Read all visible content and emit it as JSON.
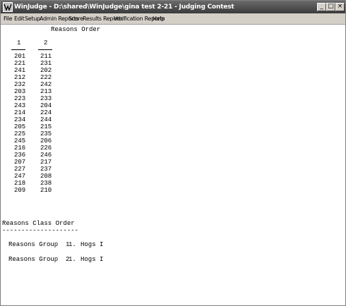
{
  "window": {
    "title": "WinJudge - D:\\shared\\WinJudge\\gina test 2-21 - Judging Contest",
    "buttons": {
      "minimize": "_",
      "restore": "□",
      "close": "×"
    }
  },
  "menu": {
    "items": [
      "File",
      "Edit",
      "Setup",
      "Admin Reports",
      "Score",
      "Results Reports",
      "Verification Reports",
      "Help"
    ]
  },
  "report": {
    "heading": "Reasons Order",
    "columns": [
      {
        "header": "1",
        "values": [
          "201",
          "221",
          "241",
          "212",
          "232",
          "203",
          "223",
          "243",
          "214",
          "234",
          "205",
          "225",
          "245",
          "216",
          "236",
          "207",
          "227",
          "247",
          "218",
          "209"
        ]
      },
      {
        "header": "2",
        "values": [
          "211",
          "231",
          "202",
          "222",
          "242",
          "213",
          "233",
          "204",
          "224",
          "244",
          "215",
          "235",
          "206",
          "226",
          "246",
          "217",
          "237",
          "208",
          "238",
          "210"
        ]
      }
    ],
    "class_order": {
      "heading": "Reasons Class Order",
      "divider": "--------------------",
      "groups": [
        {
          "label": "Reasons Group  1",
          "number": "1.",
          "name": "Hogs I"
        },
        {
          "label": "Reasons Group  2",
          "number": "1.",
          "name": "Hogs I"
        }
      ]
    }
  }
}
